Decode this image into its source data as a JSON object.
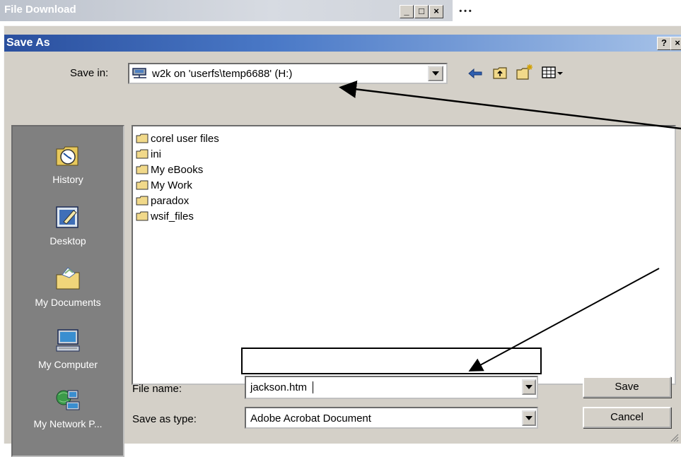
{
  "background_window": {
    "title": "File Download",
    "controls": [
      "_",
      "□",
      "×"
    ],
    "right_text": "…"
  },
  "dialog": {
    "title": "Save As",
    "help": "?",
    "close": "×",
    "save_in_label": "Save in:",
    "save_in_value": "w2k on 'userfs\\temp6688' (H:)",
    "places": [
      {
        "label": "History",
        "icon": "history-icon"
      },
      {
        "label": "Desktop",
        "icon": "desktop-icon"
      },
      {
        "label": "My Documents",
        "icon": "my-documents-icon"
      },
      {
        "label": "My Computer",
        "icon": "my-computer-icon"
      },
      {
        "label": "My Network P...",
        "icon": "network-places-icon"
      }
    ],
    "files": [
      "corel user files",
      "ini",
      "My eBooks",
      "My Work",
      "paradox",
      "wsif_files"
    ],
    "file_name_label": "File name:",
    "file_name_value": "jackson.htm",
    "save_type_label": "Save as type:",
    "save_type_value": "Adobe Acrobat Document",
    "save_button": "Save",
    "cancel_button": "Cancel"
  },
  "colors": {
    "dialog_bg": "#d4d0c8",
    "titlebar_start": "#2a4f9e",
    "places_bg": "#808080"
  }
}
